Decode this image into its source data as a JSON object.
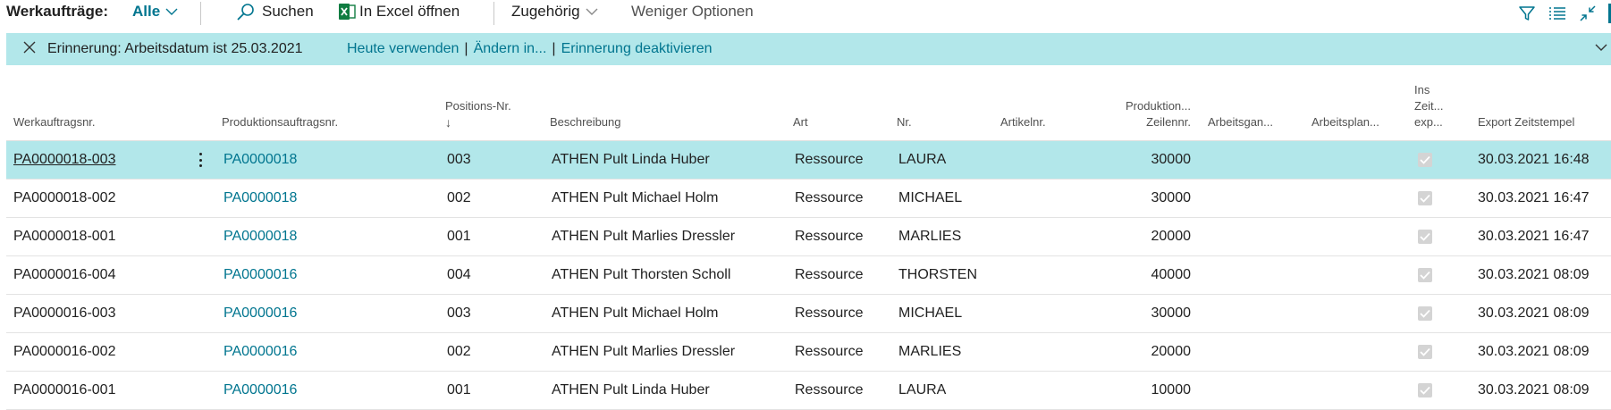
{
  "toolbar": {
    "title": "Werkaufträge:",
    "view": "Alle",
    "search": "Suchen",
    "excel": "In Excel öffnen",
    "related": "Zugehörig",
    "less_options": "Weniger Optionen"
  },
  "banner": {
    "message": "Erinnerung: Arbeitsdatum ist 25.03.2021",
    "link_today": "Heute verwenden",
    "link_change": "Ändern in...",
    "link_disable": "Erinnerung deaktivieren",
    "pipe": "|"
  },
  "columns": {
    "werkauftragsnr": "Werkauftragsnr.",
    "produktionsauftragsnr": "Produktionsauftragsnr.",
    "positions_nr": "Positions-Nr.",
    "beschreibung": "Beschreibung",
    "art": "Art",
    "nr": "Nr.",
    "artikelnr": "Artikelnr.",
    "produktion_line1": "Produktion...",
    "produktion_line2": "Zeilennr.",
    "arbeitsgang": "Arbeitsgan...",
    "arbeitsplan": "Arbeitsplan...",
    "ins_zeit_line1": "Ins",
    "ins_zeit_line2": "Zeit...",
    "ins_zeit_line3": "exp...",
    "export_zeitstempel": "Export Zeitstempel"
  },
  "rows": [
    {
      "werkauftragsnr": "PA0000018-003",
      "produktionsauftragsnr": "PA0000018",
      "positions_nr": "003",
      "beschreibung": "ATHEN Pult Linda Huber",
      "art": "Ressource",
      "nr": "LAURA",
      "zeilennr": "30000",
      "exported": true,
      "zeitstempel": "30.03.2021 16:48"
    },
    {
      "werkauftragsnr": "PA0000018-002",
      "produktionsauftragsnr": "PA0000018",
      "positions_nr": "002",
      "beschreibung": "ATHEN Pult Michael Holm",
      "art": "Ressource",
      "nr": "MICHAEL",
      "zeilennr": "30000",
      "exported": true,
      "zeitstempel": "30.03.2021 16:47"
    },
    {
      "werkauftragsnr": "PA0000018-001",
      "produktionsauftragsnr": "PA0000018",
      "positions_nr": "001",
      "beschreibung": "ATHEN Pult Marlies Dressler",
      "art": "Ressource",
      "nr": "MARLIES",
      "zeilennr": "20000",
      "exported": true,
      "zeitstempel": "30.03.2021 16:47"
    },
    {
      "werkauftragsnr": "PA0000016-004",
      "produktionsauftragsnr": "PA0000016",
      "positions_nr": "004",
      "beschreibung": "ATHEN Pult Thorsten Scholl",
      "art": "Ressource",
      "nr": "THORSTEN",
      "zeilennr": "40000",
      "exported": true,
      "zeitstempel": "30.03.2021 08:09"
    },
    {
      "werkauftragsnr": "PA0000016-003",
      "produktionsauftragsnr": "PA0000016",
      "positions_nr": "003",
      "beschreibung": "ATHEN Pult Michael Holm",
      "art": "Ressource",
      "nr": "MICHAEL",
      "zeilennr": "30000",
      "exported": true,
      "zeitstempel": "30.03.2021 08:09"
    },
    {
      "werkauftragsnr": "PA0000016-002",
      "produktionsauftragsnr": "PA0000016",
      "positions_nr": "002",
      "beschreibung": "ATHEN Pult Marlies Dressler",
      "art": "Ressource",
      "nr": "MARLIES",
      "zeilennr": "20000",
      "exported": true,
      "zeitstempel": "30.03.2021 08:09"
    },
    {
      "werkauftragsnr": "PA0000016-001",
      "produktionsauftragsnr": "PA0000016",
      "positions_nr": "001",
      "beschreibung": "ATHEN Pult Linda Huber",
      "art": "Ressource",
      "nr": "LAURA",
      "zeilennr": "10000",
      "exported": true,
      "zeitstempel": "30.03.2021 08:09"
    }
  ],
  "colors": {
    "accent": "#00758f",
    "banner_bg": "#b2e7ea",
    "excel_green": "#107c41"
  },
  "icons": {
    "filter": "filter-icon",
    "list": "list-view-icon",
    "collapse": "collapse-icon",
    "search": "search-icon",
    "excel": "excel-icon",
    "close": "close-icon",
    "sort": "arrow-down-icon"
  }
}
